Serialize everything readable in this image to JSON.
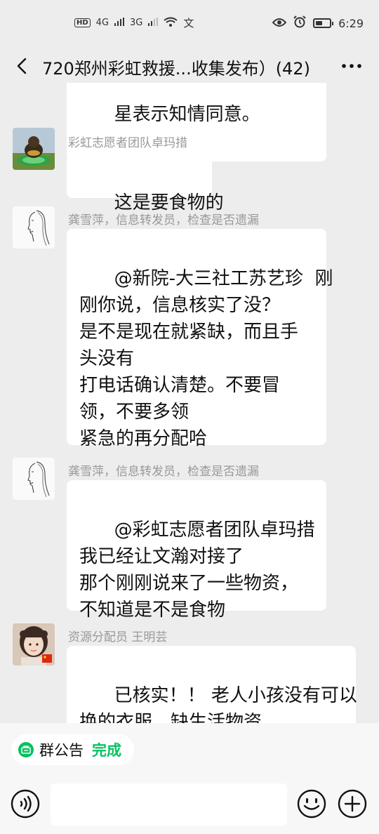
{
  "status_bar": {
    "left_indicators": [
      "HD",
      "4G",
      "3G"
    ],
    "time": "6:29"
  },
  "nav": {
    "title": "720郑州彩虹救援...收集发布）(42)"
  },
  "messages": [
    {
      "sender": "",
      "text": "星表示知情同意。",
      "avatar": "none"
    },
    {
      "sender": "彩虹志愿者团队卓玛措",
      "text": "这是要食物的",
      "avatar": "figurine-photo"
    },
    {
      "sender": "龚雪萍，信息转发员，检查是否遗漏",
      "text": "@新院-大三社工苏艺珍  刚\n刚你说，信息核实了没？\n是不是现在就紧缺，而且手\n头没有\n打电话确认清楚。不要冒\n领，不要多领\n紧急的再分配哈",
      "avatar": "girl-sketch"
    },
    {
      "sender": "龚雪萍，信息转发员，检查是否遗漏",
      "text": "@彩虹志愿者团队卓玛措\n我已经让文瀚对接了\n那个刚刚说来了一些物资，\n不知道是不是食物",
      "avatar": "girl-sketch"
    },
    {
      "sender": "资源分配员 王明芸",
      "text": "已核实！！ 老人小孩没有可以\n换的衣服，缺生活物资",
      "avatar": "girl-photo"
    }
  ],
  "group_notice": {
    "label": "群公告",
    "status": "完成"
  },
  "colors": {
    "background": "#ededed",
    "bubble": "#ffffff",
    "accent_green": "#07c160",
    "sender_text": "#999999"
  },
  "icons": [
    "back-icon",
    "more-icon",
    "voice-icon",
    "emoji-icon",
    "plus-icon",
    "notice-icon"
  ]
}
